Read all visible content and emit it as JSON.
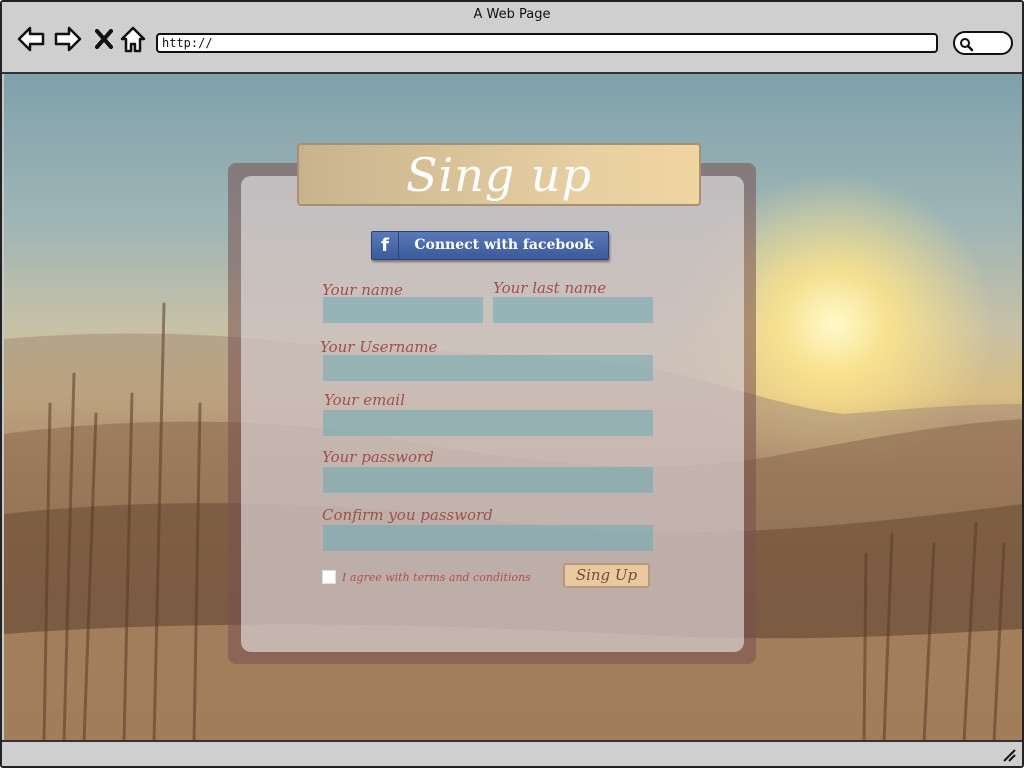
{
  "browser": {
    "window_title": "A Web Page",
    "url": "http://"
  },
  "form": {
    "title": "Sing up",
    "facebook_button": {
      "icon": "f",
      "label": "Connect with facebook"
    },
    "fields": {
      "first_name": {
        "label": "Your name",
        "value": ""
      },
      "last_name": {
        "label": "Your last name",
        "value": ""
      },
      "username": {
        "label": "Your Username",
        "value": ""
      },
      "email": {
        "label": "Your email",
        "value": ""
      },
      "password": {
        "label": "Your password",
        "value": ""
      },
      "confirm_password": {
        "label": "Confirm you password",
        "value": ""
      }
    },
    "agree_label": "I agree with terms and conditions",
    "agree_checked": false,
    "submit_label": "Sing Up"
  },
  "colors": {
    "label": "#a0504a",
    "input": "#6caab4",
    "facebook": "#3b5a9a"
  }
}
